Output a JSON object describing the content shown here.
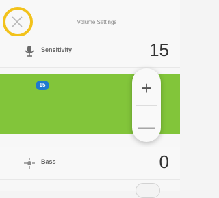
{
  "header": {
    "title": "Volume Settings"
  },
  "rows": [
    {
      "label": "Sensitivity",
      "value": "15",
      "icon": "microphone-icon"
    },
    {
      "label": "Bass",
      "value": "0",
      "icon": "bass-icon"
    }
  ],
  "slider": {
    "bubble_value": "15",
    "plus_label": "+",
    "minus_label": "—"
  },
  "colors": {
    "accent_green": "#82c53a",
    "bubble_blue": "#1f79cf",
    "highlight_ring": "#f2c21b"
  }
}
